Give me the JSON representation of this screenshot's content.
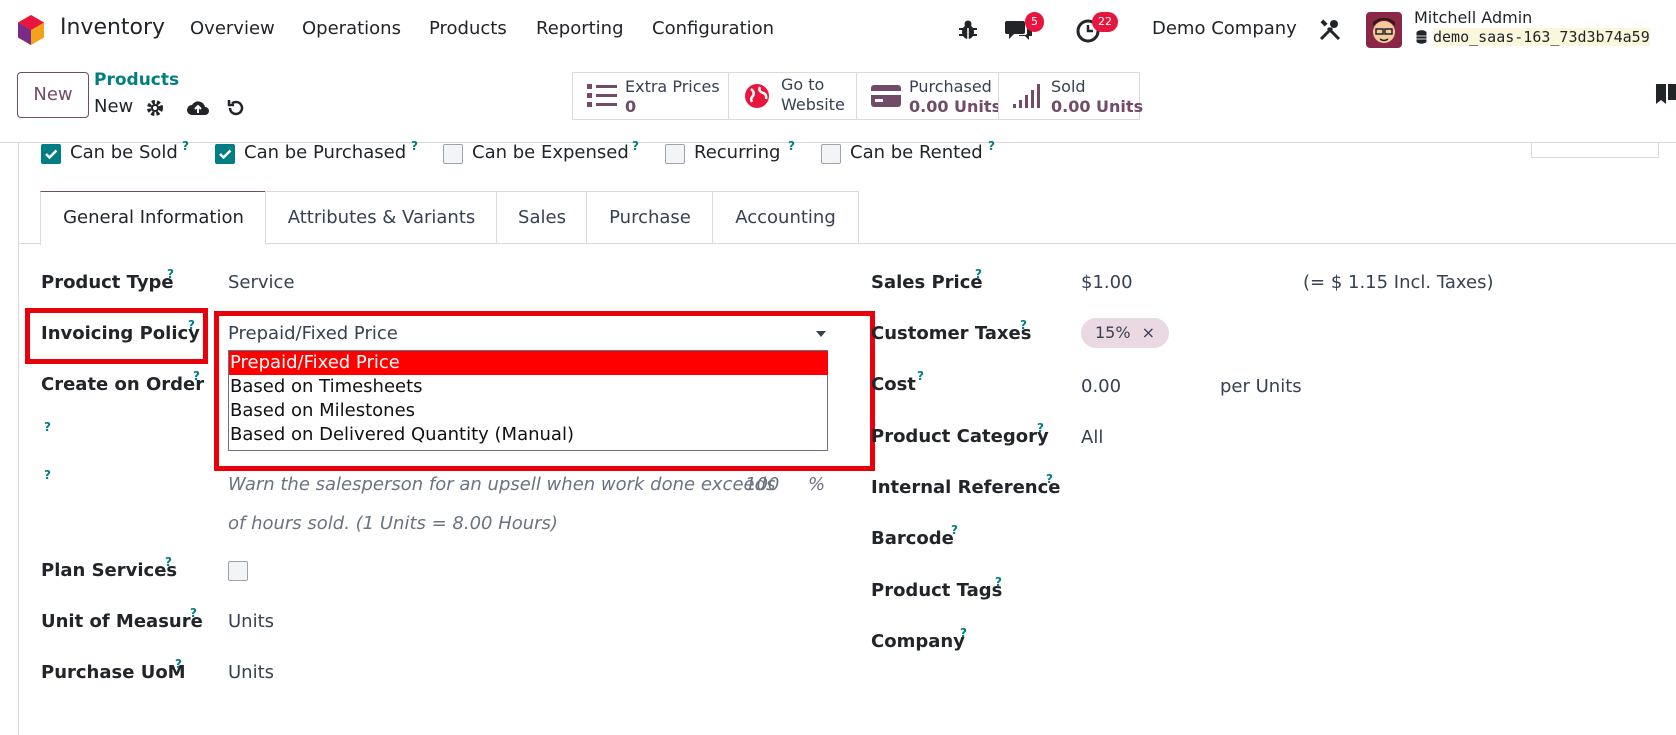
{
  "navbar": {
    "app_name": "Inventory",
    "menu": [
      "Overview",
      "Operations",
      "Products",
      "Reporting",
      "Configuration"
    ],
    "messages_count": "5",
    "activities_count": "22",
    "company": "Demo Company",
    "user_name": "Mitchell Admin",
    "database": "demo_saas-163_73d3b74a59"
  },
  "controlbar": {
    "new_label": "New",
    "breadcrumb": "Products",
    "record_name": "New"
  },
  "stat_buttons": [
    {
      "label": "Extra Prices",
      "value": "0",
      "icon": "list-icon"
    },
    {
      "label": "Go to",
      "label2": "Website",
      "icon": "globe-icon"
    },
    {
      "label": "Purchased",
      "value": "0.00 Units",
      "icon": "credit-card-icon"
    },
    {
      "label": "Sold",
      "value": "0.00 Units",
      "icon": "signal-bars-icon"
    }
  ],
  "checkboxes": [
    {
      "label": "Can be Sold",
      "checked": true
    },
    {
      "label": "Can be Purchased",
      "checked": true
    },
    {
      "label": "Can be Expensed",
      "checked": false
    },
    {
      "label": "Recurring",
      "checked": false
    },
    {
      "label": "Can be Rented",
      "checked": false
    }
  ],
  "tabs": [
    "General Information",
    "Attributes & Variants",
    "Sales",
    "Purchase",
    "Accounting"
  ],
  "left_fields": {
    "product_type": {
      "label": "Product Type",
      "value": "Service"
    },
    "invoicing_policy": {
      "label": "Invoicing Policy",
      "value": "Prepaid/Fixed Price"
    },
    "create_on_order": {
      "label": "Create on Order"
    },
    "upsell_warning": "Warn the salesperson for an upsell when work done exceeds",
    "upsell_value": "100",
    "upsell_unit": "%",
    "upsell_note": "of hours sold. (1 Units = 8.00 Hours)",
    "plan_services": {
      "label": "Plan Services"
    },
    "unit_of_measure": {
      "label": "Unit of Measure",
      "value": "Units"
    },
    "purchase_uom": {
      "label": "Purchase UoM",
      "value": "Units"
    }
  },
  "invoicing_options": [
    "Prepaid/Fixed Price",
    "Based on Timesheets",
    "Based on Milestones",
    "Based on Delivered Quantity (Manual)"
  ],
  "right_fields": {
    "sales_price": {
      "label": "Sales Price",
      "value": "$1.00",
      "incl": "(= $ 1.15 Incl. Taxes)"
    },
    "customer_taxes": {
      "label": "Customer Taxes",
      "tag": "15%",
      "remove": "×"
    },
    "cost": {
      "label": "Cost",
      "value": "0.00",
      "unit": "per Units"
    },
    "product_category": {
      "label": "Product Category",
      "value": "All"
    },
    "internal_reference": {
      "label": "Internal Reference"
    },
    "barcode": {
      "label": "Barcode"
    },
    "product_tags": {
      "label": "Product Tags"
    },
    "company": {
      "label": "Company"
    }
  },
  "help_mark": "?"
}
